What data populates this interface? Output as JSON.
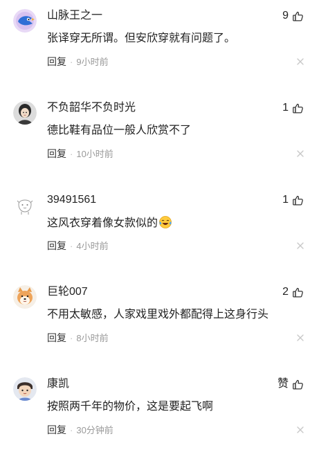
{
  "comments": [
    {
      "username": "山脉王之一",
      "likes": "9",
      "content": "张译穿无所谓。但安欣穿就有问题了。",
      "emoji": "",
      "reply_label": "回复",
      "time": "9小时前",
      "avatar": "blue-bird-avatar"
    },
    {
      "username": "不负韶华不负时光",
      "likes": "1",
      "content": "德比鞋有品位一般人欣赏不了",
      "emoji": "",
      "reply_label": "回复",
      "time": "10小时前",
      "avatar": "portrait-avatar"
    },
    {
      "username": "39491561",
      "likes": "1",
      "content": "这风衣穿着像女款似的",
      "emoji": "laughing-tears-emoji",
      "reply_label": "回复",
      "time": "4小时前",
      "avatar": "default-sketch-avatar"
    },
    {
      "username": "巨轮007",
      "likes": "2",
      "content": "不用太敏感，人家戏里戏外都配得上这身行头",
      "emoji": "",
      "reply_label": "回复",
      "time": "8小时前",
      "avatar": "shiba-dog-avatar"
    },
    {
      "username": "康凯",
      "likes": "赞",
      "content": "按照两千年的物价，这是要起飞啊",
      "emoji": "",
      "reply_label": "回复",
      "time": "30分钟前",
      "avatar": "cartoon-character-avatar"
    }
  ],
  "icons": {
    "like": "thumbs-up-icon",
    "close": "close-icon",
    "separator": "dot"
  },
  "colors": {
    "text_primary": "#222222",
    "text_secondary": "#999999",
    "close_icon": "#c8c8c8"
  }
}
